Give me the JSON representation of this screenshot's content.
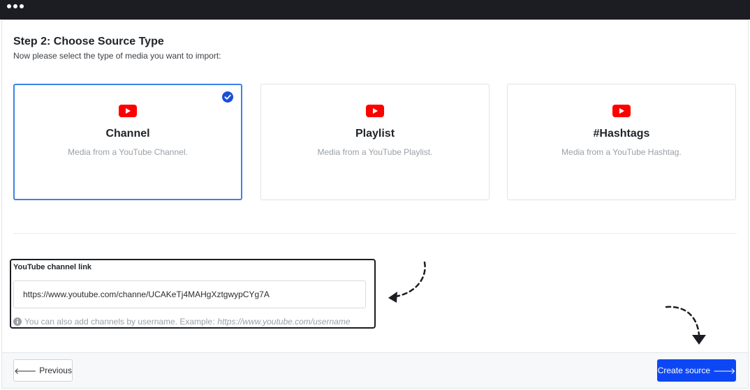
{
  "header": {
    "title": "Step 2: Choose Source Type",
    "subtitle": "Now please select the type of media you want to import:"
  },
  "source_types": [
    {
      "title": "Channel",
      "description": "Media from a YouTube Channel.",
      "selected": true,
      "icon": "youtube-icon"
    },
    {
      "title": "Playlist",
      "description": "Media from a YouTube Playlist.",
      "selected": false,
      "icon": "youtube-icon"
    },
    {
      "title": "#Hashtags",
      "description": "Media from a YouTube Hashtag.",
      "selected": false,
      "icon": "youtube-icon"
    }
  ],
  "channel_link": {
    "label": "YouTube channel link",
    "value": "https://www.youtube.com/channe/UCAKeTj4MAHgXztgwypCYg7A",
    "hint": "You can also add channels by username. Example:",
    "hint_example": "https://www.youtube.com/username"
  },
  "footer": {
    "previous_label": "Previous",
    "create_label": "Create source"
  },
  "colors": {
    "accent": "#0d47f5",
    "selected_border": "#3b82e6",
    "youtube_red": "#ff0000",
    "topbar": "#1b1d22"
  }
}
